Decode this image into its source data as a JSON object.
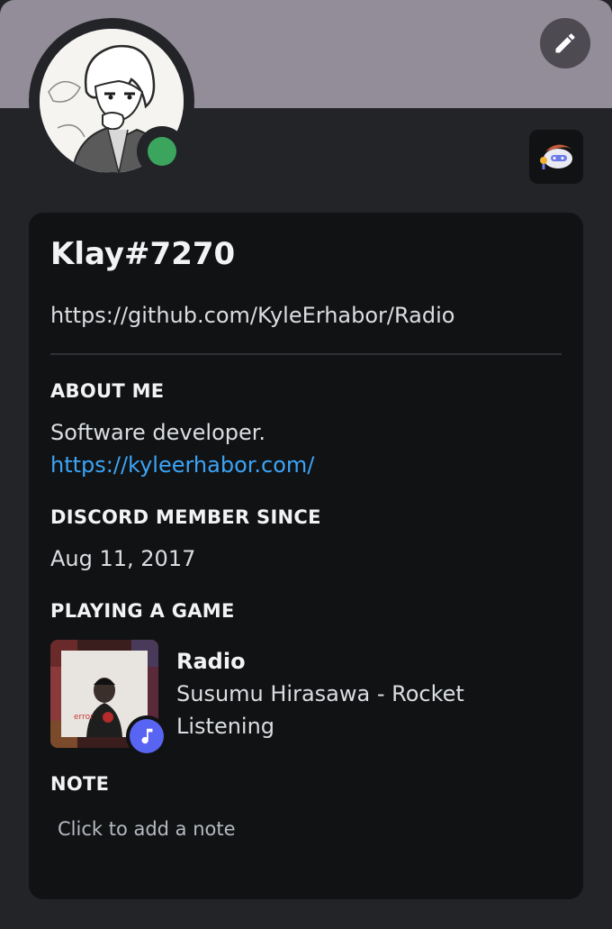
{
  "banner_color": "#938c99",
  "status": {
    "state": "online",
    "color": "#3ba55d"
  },
  "header": {
    "edit_icon": "pencil-icon",
    "badge_icon": "nitro-wumpus-icon"
  },
  "profile": {
    "username": "Klay#7270",
    "custom_status": "https://github.com/KyleErhabor/Radio"
  },
  "about": {
    "title": "ABOUT ME",
    "text": "Software developer.",
    "link": "https://kyleerhabor.com/"
  },
  "member_since": {
    "title": "DISCORD MEMBER SINCE",
    "date": "Aug 11, 2017"
  },
  "activity": {
    "title": "PLAYING A GAME",
    "name": "Radio",
    "details": "Susumu Hirasawa - Rocket",
    "state": "Listening",
    "icon": "music-note-icon",
    "album_text": "error"
  },
  "note": {
    "title": "NOTE",
    "placeholder": "Click to add a note"
  },
  "colors": {
    "accent_link": "#3ca4f6",
    "blurple": "#5865f2",
    "card_bg": "#111214",
    "page_bg": "#232428"
  }
}
